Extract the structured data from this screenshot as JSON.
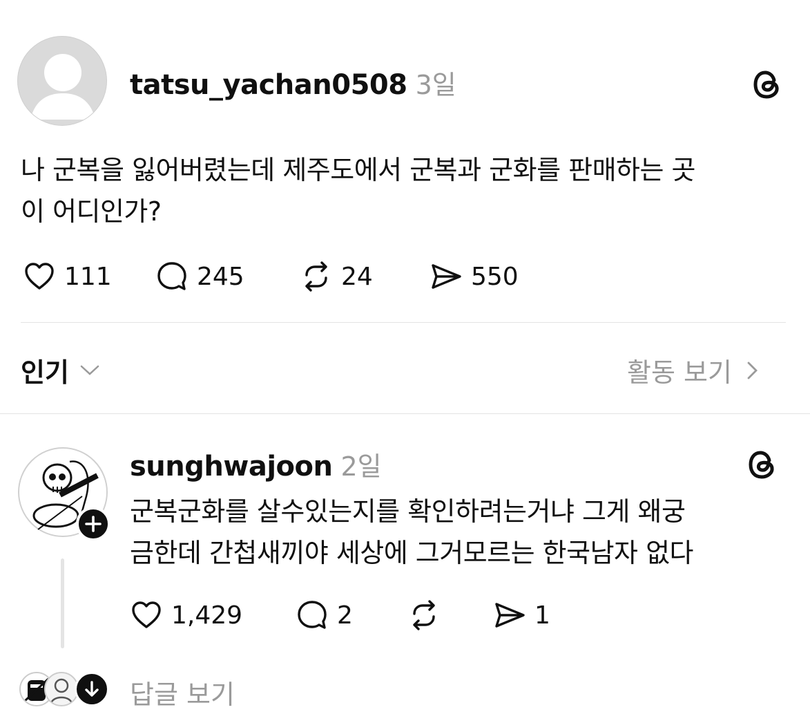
{
  "post": {
    "username": "tatsu_yachan0508",
    "time": "3일",
    "text_line1": "나 군복을 잃어버렸는데 제주도에서 군복과 군화를 판매하는 곳",
    "text_line2": "이 어디인가?",
    "likes": "111",
    "comments": "245",
    "reposts": "24",
    "shares": "550"
  },
  "sort": {
    "label": "인기",
    "activity_label": "활동 보기"
  },
  "reply": {
    "username": "sunghwajoon",
    "time": "2일",
    "text_line1": "군복군화를 살수있는지를 확인하려는거냐  그게 왜궁",
    "text_line2": "금한데 간첩새끼야 세상에 그거모르는 한국남자 없다",
    "likes": "1,429",
    "comments": "2",
    "shares": "1",
    "view_replies_label": "답글 보기"
  },
  "icons": {
    "threads_logo": "threads-logo-icon",
    "like": "heart-icon",
    "comment": "comment-bubble-icon",
    "repost": "repost-icon",
    "share": "send-icon",
    "chevron_down": "chevron-down-icon",
    "chevron_right": "chevron-right-icon",
    "follow_plus": "plus-icon",
    "arrow_down": "arrow-down-icon"
  }
}
